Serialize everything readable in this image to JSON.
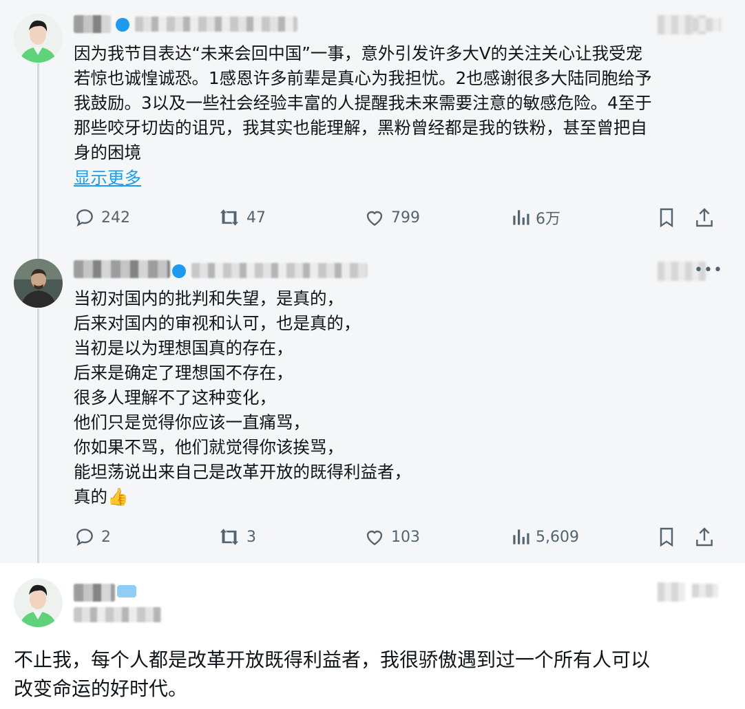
{
  "tweets": [
    {
      "text": "因为我节目表达“未来会回中国”一事，意外引发许多大V的关注关心让我受宠\n若惊也诚惶诚恐。1感恩许多前辈是真心为我担忧。2也感谢很多大陆同胞给予\n我鼓励。3以及一些社会经验丰富的人提醒我未来需要注意的敏感危险。4至于\n那些咬牙切齿的诅咒，我其实也能理解，黑粉曾经都是我的铁粉，甚至曾把自\n身的困境",
      "show_more": "显示更多",
      "replies": "242",
      "retweets": "47",
      "likes": "799",
      "views": "6万"
    },
    {
      "text": "当初对国内的批判和失望，是真的，\n后来对国内的审视和认可，也是真的，\n当初是以为理想国真的存在，\n后来是确定了理想国不存在，\n很多人理解不了这种变化，\n他们只是觉得你应该一直痛骂，\n你如果不骂，他们就觉得你该挨骂，\n能坦荡说出来自己是改革开放的既得利益者，\n真的👍",
      "replies": "2",
      "retweets": "3",
      "likes": "103",
      "views": "5,609"
    },
    {
      "text": "不止我，每个人都是改革开放既得利益者，我很骄傲遇到过一个所有人可以\n改变命运的好时代。"
    }
  ],
  "colors": {
    "accent": "#1d9bf0",
    "secondary_text": "#536471",
    "panel_bg": "#f5f6f7"
  },
  "icons": [
    "reply-icon",
    "retweet-icon",
    "like-icon",
    "views-icon",
    "bookmark-icon",
    "share-icon",
    "more-icon"
  ]
}
